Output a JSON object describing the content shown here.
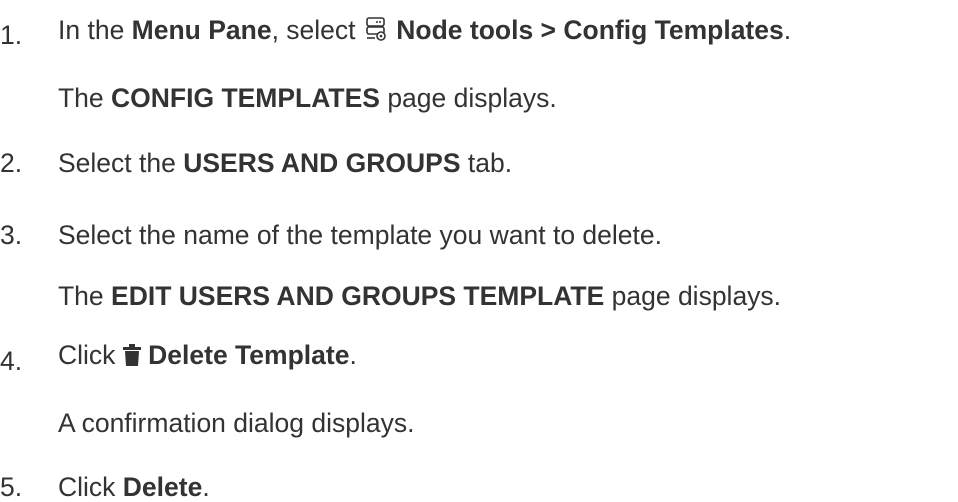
{
  "steps": [
    {
      "number": "1.",
      "parts": {
        "a": "In the ",
        "b": "Menu Pane",
        "c": ", select ",
        "d": "Node tools > Config Templates",
        "e": "."
      },
      "icon": "node-tools-icon",
      "result": {
        "b": "CONFIG TEMPLATES",
        "c": " page displays."
      }
    },
    {
      "number": "2.",
      "parts": {
        "a": "Select the ",
        "b": "USERS AND GROUPS",
        "c": " tab."
      }
    },
    {
      "number": "3.",
      "parts": {
        "a": "Select the name of the template you want to delete."
      },
      "result": {
        "a": "The ",
        "b": "EDIT USERS AND GROUPS TEMPLATE",
        "c": " page displays."
      }
    },
    {
      "number": "4.",
      "parts": {
        "a": "Click ",
        "b": "Delete Template",
        "c": "."
      },
      "icon": "trash-icon",
      "result": {
        "a": "A confirmation dialog displays."
      }
    },
    {
      "number": "5.",
      "parts": {
        "a": "Click ",
        "b": "Delete",
        "c": "."
      }
    }
  ],
  "result_prefix": "The "
}
